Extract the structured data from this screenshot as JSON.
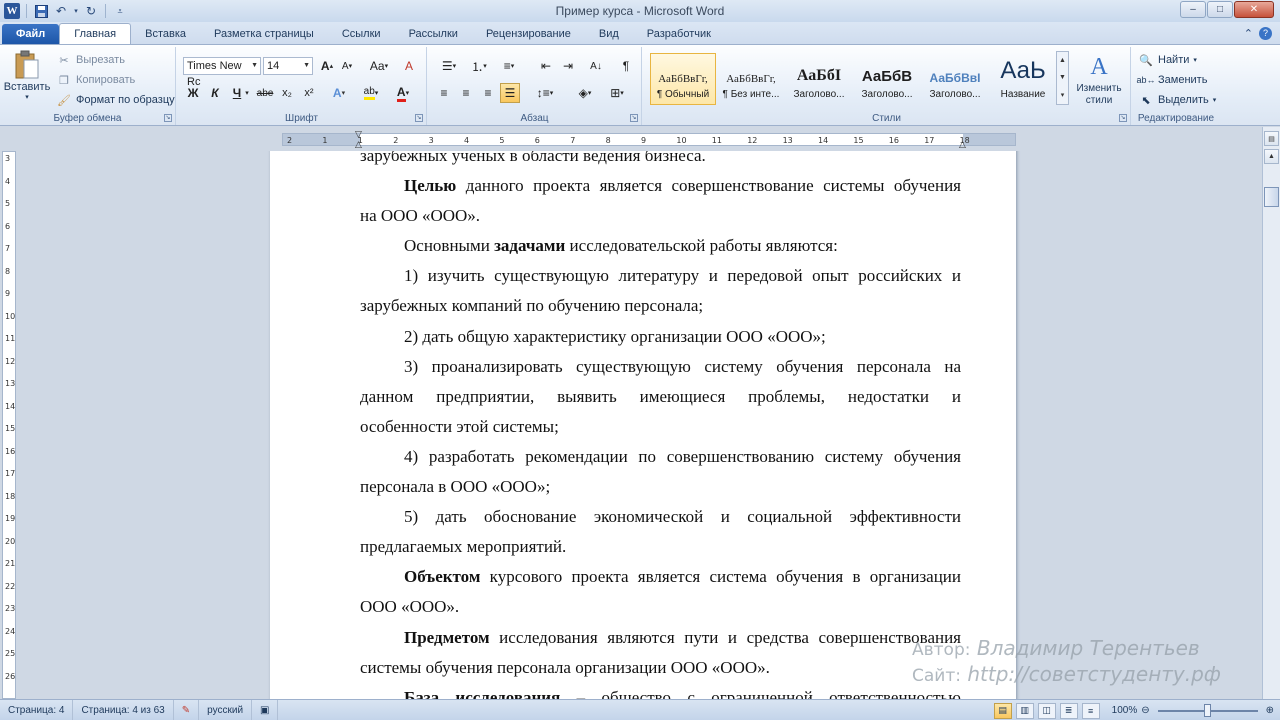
{
  "window": {
    "title": "Пример курса  -  Microsoft Word",
    "minimize": "–",
    "maximize": "□",
    "close": "✕"
  },
  "tabs": [
    "Файл",
    "Главная",
    "Вставка",
    "Разметка страницы",
    "Ссылки",
    "Рассылки",
    "Рецензирование",
    "Вид",
    "Разработчик"
  ],
  "ribbon": {
    "clipboard": {
      "paste": "Вставить",
      "cut": "Вырезать",
      "copy": "Копировать",
      "format_painter": "Формат по образцу",
      "label": "Буфер обмена"
    },
    "font": {
      "name": "Times New Rc",
      "size": "14",
      "label": "Шрифт",
      "bold": "Ж",
      "italic": "К",
      "underline": "Ч",
      "strike": "abe",
      "sub": "x₂",
      "sup": "x²",
      "grow": "A",
      "shrink": "A",
      "case": "Aa",
      "clear": "A"
    },
    "paragraph": {
      "label": "Абзац"
    },
    "styles": {
      "label": "Стили",
      "items": [
        {
          "preview": "АаБбВвГг,",
          "name": "¶ Обычный"
        },
        {
          "preview": "АаБбВвГг,",
          "name": "¶ Без инте..."
        },
        {
          "preview": "АаБбІ",
          "name": "Заголово..."
        },
        {
          "preview": "АаБбВ",
          "name": "Заголово..."
        },
        {
          "preview": "АаБбВвІ",
          "name": "Заголово..."
        },
        {
          "preview": "АаЬ",
          "name": "Название"
        }
      ],
      "change": "Изменить стили"
    },
    "editing": {
      "label": "Редактирование",
      "find": "Найти",
      "replace": "Заменить",
      "select": "Выделить"
    }
  },
  "ruler": {
    "ticks": [
      "2",
      "1",
      "1",
      "2",
      "3",
      "4",
      "5",
      "6",
      "7",
      "8",
      "9",
      "10",
      "11",
      "12",
      "13",
      "14",
      "15",
      "16",
      "17",
      "18"
    ],
    "vticks": [
      "3",
      "4",
      "5",
      "6",
      "7",
      "8",
      "9",
      "10",
      "11",
      "12",
      "13",
      "14",
      "15",
      "16",
      "17",
      "18",
      "19",
      "20",
      "21",
      "22",
      "23",
      "24",
      "25",
      "26"
    ]
  },
  "document": {
    "top_fragment": "зарубежных ученых в области ведения бизнеса.",
    "p1_bold": "Целью",
    "p1_l1": " данного проекта является совершенствование системы обучения",
    "p1_l2": "на ООО «ООО».",
    "p2_a": "Основными ",
    "p2_bold": "задачами",
    "p2_b": " исследовательской работы являются:",
    "i1_l1": "1) изучить существующую литературу и передовой опыт российских и",
    "i1_l2": "зарубежных компаний по обучению персонала;",
    "i2": "2) дать общую характеристику организации ООО «ООО»;",
    "i3_l1": "3) проанализировать существующую систему обучения персонала на",
    "i3_l2": "данном предприятии, выявить имеющиеся проблемы, недостатки и",
    "i3_l3": "особенности этой системы;",
    "i4_l1": "4) разработать рекомендации по совершенствованию систему обучения",
    "i4_l2": "персонала в ООО «ООО»;",
    "i5_l1": "5) дать обоснование экономической и социальной эффективности",
    "i5_l2": "предлагаемых мероприятий.",
    "obj_bold": "Объектом",
    "obj_l1": " курсового проекта является система обучения в организации",
    "obj_l2": "ООО «ООО».",
    "subj_bold": "Предметом",
    "subj_l1": " исследования являются пути и средства совершенствования",
    "subj_l2": "системы обучения персонала организации ООО «ООО».",
    "base_bold": "База исследования",
    "base_l1": " – общество с ограниченной ответственностью"
  },
  "watermark": {
    "author_label": "Автор:",
    "author": "Владимир Терентьев",
    "site_label": "Сайт:",
    "site": "http://советстуденту.рф"
  },
  "status": {
    "page": "Страница: 4",
    "page_of": "Страница: 4 из 63",
    "language": "русский",
    "zoom": "100%"
  }
}
